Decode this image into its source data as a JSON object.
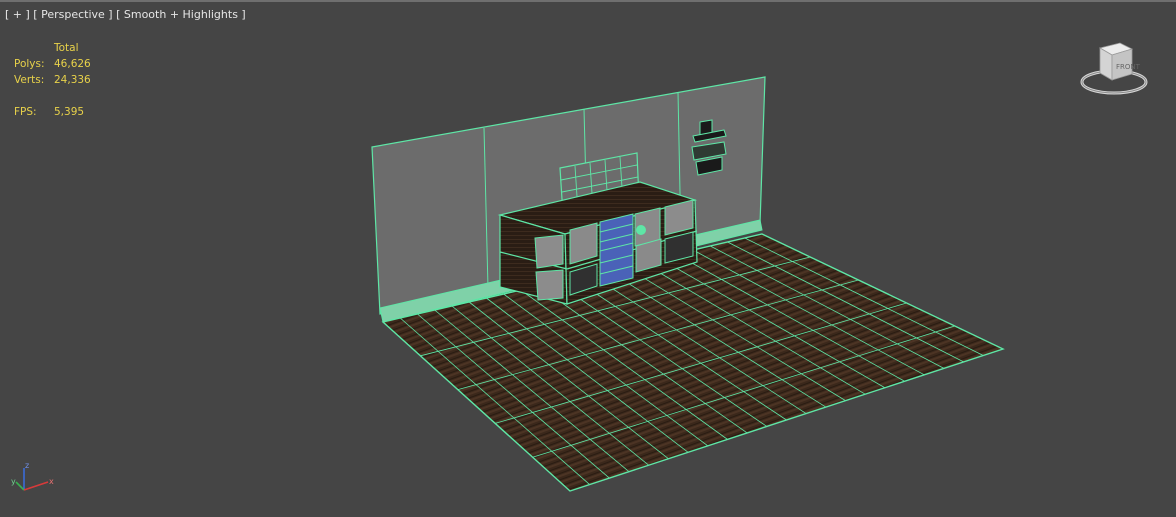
{
  "viewport": {
    "label_plus": "[ + ]",
    "label_view": "[ Perspective ]",
    "label_shading": "[ Smooth + Highlights ]",
    "background": "#454545"
  },
  "stats": {
    "header": "Total",
    "polys_label": "Polys:",
    "polys_value": "46,626",
    "verts_label": "Verts:",
    "verts_value": "24,336",
    "fps_label": "FPS:",
    "fps_value": "5,395",
    "color": "#e8d24a"
  },
  "viewcube": {
    "icon": "viewcube-icon",
    "face_label": "FRONT"
  },
  "axis_tripod": {
    "x": "x",
    "y": "y",
    "z": "z"
  },
  "colors": {
    "wireframe": "#5ee6a6",
    "wall": "#6a6a6a",
    "floor": "#3e2a1c",
    "drawers": "#4a62b8"
  }
}
